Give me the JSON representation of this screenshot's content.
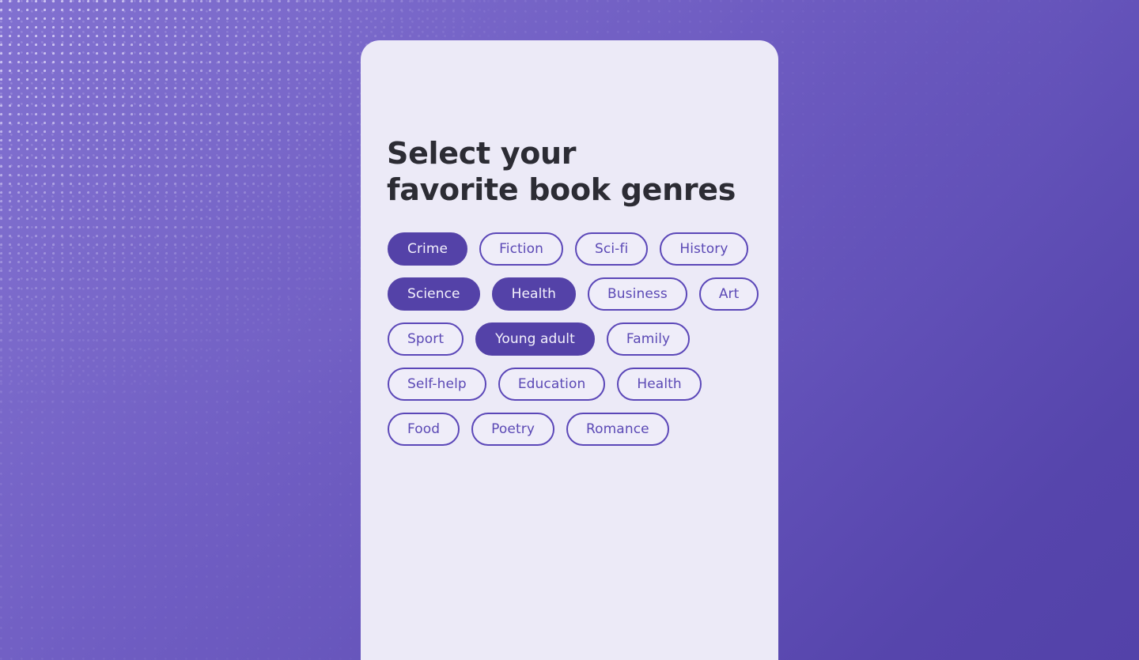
{
  "theme": {
    "background_gradient_start": "#8170d0",
    "background_gradient_end": "#5342a9",
    "card_background": "#eceaf7",
    "accent_purple": "#5442a8",
    "chip_border": "#5b47b8",
    "chip_text": "#5b49b5",
    "chip_selected_text": "#f4f2fc",
    "title_color": "#2c2c34"
  },
  "card": {
    "title": "Select your\nfavorite book genres",
    "title_line_1": "Select your",
    "title_line_2": "favorite book genres"
  },
  "genres": [
    {
      "label": "Crime",
      "selected": true
    },
    {
      "label": "Fiction",
      "selected": false
    },
    {
      "label": "Sci-fi",
      "selected": false
    },
    {
      "label": "History",
      "selected": false
    },
    {
      "label": "Science",
      "selected": true
    },
    {
      "label": "Health",
      "selected": true
    },
    {
      "label": "Business",
      "selected": false
    },
    {
      "label": "Art",
      "selected": false
    },
    {
      "label": "Sport",
      "selected": false
    },
    {
      "label": "Young adult",
      "selected": true
    },
    {
      "label": "Family",
      "selected": false
    },
    {
      "label": "Self-help",
      "selected": false
    },
    {
      "label": "Education",
      "selected": false
    },
    {
      "label": "Health",
      "selected": false
    },
    {
      "label": "Food",
      "selected": false
    },
    {
      "label": "Poetry",
      "selected": false
    },
    {
      "label": "Romance",
      "selected": false
    }
  ]
}
